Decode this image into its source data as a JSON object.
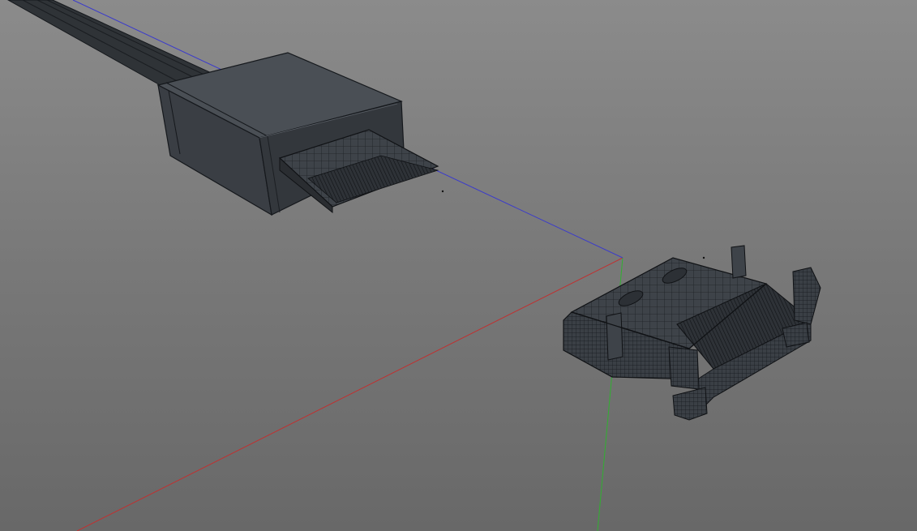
{
  "viewport": {
    "name": "3d-perspective-viewport",
    "colors": {
      "background_top": "#8b8b8b",
      "background_bottom": "#686868",
      "axis_x": "#c03030",
      "axis_y": "#30b030",
      "axis_z": "#3a3acc",
      "mesh_fill": "#3e4349",
      "mesh_edge": "#15181c"
    },
    "objects": [
      {
        "name": "hdmi-cable-plug",
        "icon": "connector-plug-mesh"
      },
      {
        "name": "hdmi-socket-port",
        "icon": "connector-socket-mesh"
      }
    ]
  }
}
